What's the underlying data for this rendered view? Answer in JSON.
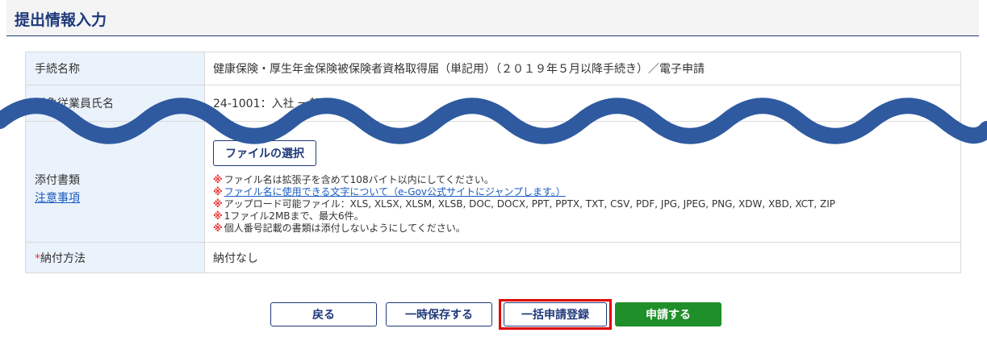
{
  "page_title": "提出情報入力",
  "form": {
    "rows": [
      {
        "label": "手続名称",
        "value": "健康保険・厚生年金保険被保険者資格取得届（単記用）（２０１９年５月以降手続き）／電子申請"
      },
      {
        "label": "対象従業員氏名",
        "value": "24-1001：入社 一郎"
      },
      {
        "label": "添付書類",
        "label_link": "注意事項"
      },
      {
        "label": "納付方法",
        "required_mark": "*",
        "value": "納付なし"
      }
    ],
    "attachment": {
      "button_label": "ファイルの選択",
      "note_mark": "※",
      "notes": [
        "ファイル名は拡張子を含めて108バイト以内にしてください。",
        "ファイル名に使用できる文字について（e-Gov公式サイトにジャンプします。）",
        "アップロード可能ファイル：XLS, XLSX, XLSM, XLSB, DOC, DOCX, PPT, PPTX, TXT, CSV, PDF, JPG, JPEG, PNG, XDW, XBD, XCT, ZIP",
        "1ファイル2MBまで、最大6件。",
        "個人番号記載の書類は添付しないようにしてください。"
      ]
    }
  },
  "actions": {
    "back": "戻る",
    "save_draft": "一時保存する",
    "bulk_register": "一括申請登録",
    "apply": "申請する"
  },
  "colors": {
    "brand_navy": "#1f3a7a",
    "label_bg": "#eaf2fb",
    "apply_green": "#1f8f2a",
    "highlight_red": "#e00000",
    "wave_blue": "#2f5aa0"
  }
}
